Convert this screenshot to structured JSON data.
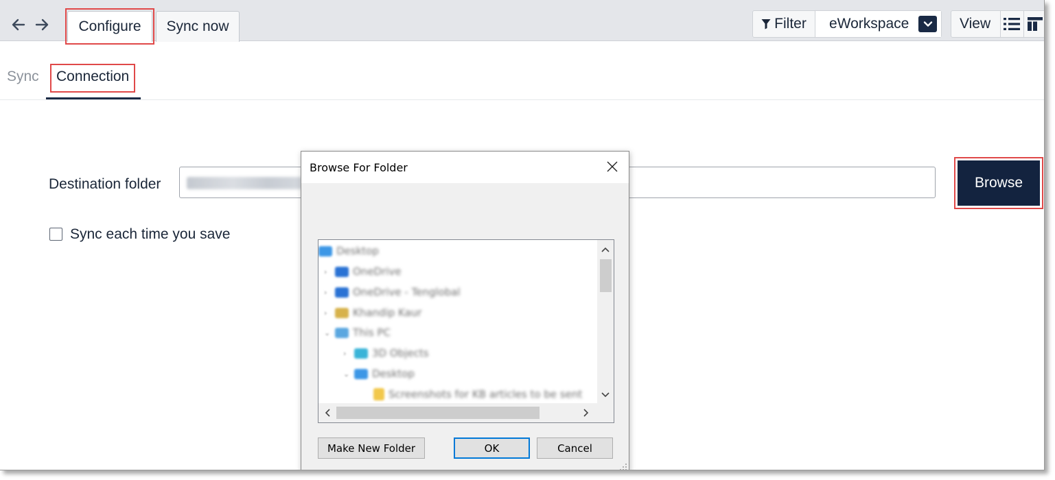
{
  "toolbar": {
    "back_icon": "arrow-left-icon",
    "forward_icon": "arrow-right-icon",
    "tabs": [
      {
        "label": "Configure",
        "active": true
      },
      {
        "label": "Sync now",
        "active": false
      }
    ],
    "filter_label": "Filter",
    "workspace_select": "eWorkspace",
    "view_label": "View",
    "icons": [
      "filter-icon",
      "chevron-down-icon",
      "list-view-icon",
      "layout-view-icon"
    ]
  },
  "subtabs": [
    {
      "label": "Sync",
      "active": false
    },
    {
      "label": "Connection",
      "active": true
    }
  ],
  "form": {
    "destination_label": "Destination folder",
    "destination_value": "",
    "browse_label": "Browse",
    "sync_checkbox_label": "Sync each time you save",
    "sync_checkbox_checked": false
  },
  "dialog": {
    "title": "Browse For Folder",
    "close_icon": "close-icon",
    "make_new_folder_label": "Make New Folder",
    "ok_label": "OK",
    "cancel_label": "Cancel",
    "tree_items": [
      {
        "label": "Desktop",
        "icon": "desktop-folder-icon",
        "color": "#3c97e6"
      },
      {
        "label": "OneDrive",
        "icon": "cloud-icon",
        "color": "#2a72d4"
      },
      {
        "label": "OneDrive - Tenglobal",
        "icon": "cloud-icon",
        "color": "#2a72d4"
      },
      {
        "label": "Khandip Kaur",
        "icon": "user-folder-icon",
        "color": "#d7b24a"
      },
      {
        "label": "This PC",
        "icon": "computer-icon",
        "color": "#5aa7e0"
      },
      {
        "label": "3D Objects",
        "icon": "3d-objects-icon",
        "color": "#39b4d8"
      },
      {
        "label": "Desktop",
        "icon": "desktop-folder-icon",
        "color": "#3c97e6"
      },
      {
        "label": "Screenshots for KB articles to be sent",
        "icon": "folder-icon",
        "color": "#f2c84b"
      }
    ]
  },
  "highlight_color": "#e04848",
  "accent_color": "#13233f"
}
